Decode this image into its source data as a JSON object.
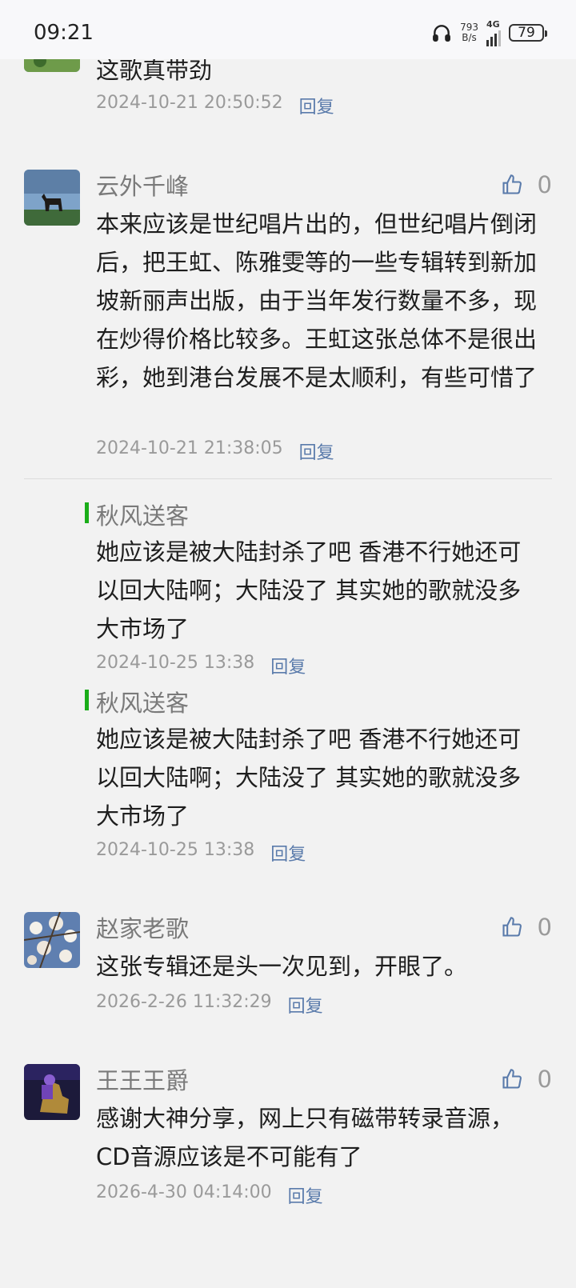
{
  "status": {
    "time": "09:21",
    "net_speed_value": "793",
    "net_speed_unit": "B/s",
    "network": "4G",
    "battery": "79"
  },
  "comments": [
    {
      "text": "这歌真带劲",
      "time": "2024-10-21 20:50:52",
      "reply": "回复"
    },
    {
      "user": "云外千峰",
      "likes": "0",
      "text": "本来应该是世纪唱片出的，但世纪唱片倒闭后，把王虹、陈雅雯等的一些专辑转到新加坡新丽声出版，由于当年发行数量不多，现在炒得价格比较多。王虹这张总体不是很出彩，她到港台发展不是太顺利，有些可惜了",
      "time": "2024-10-21 21:38:05",
      "reply": "回复",
      "replies": [
        {
          "user": "秋风送客",
          "text": "她应该是被大陆封杀了吧  香港不行她还可以回大陆啊；大陆没了 其实她的歌就没多大市场了",
          "time": "2024-10-25 13:38",
          "reply": "回复"
        },
        {
          "user": "秋风送客",
          "text": "她应该是被大陆封杀了吧  香港不行她还可以回大陆啊；大陆没了 其实她的歌就没多大市场了",
          "time": "2024-10-25 13:38",
          "reply": "回复"
        }
      ]
    },
    {
      "user": "赵家老歌",
      "likes": "0",
      "text": "这张专辑还是头一次见到，开眼了。",
      "time": "2026-2-26 11:32:29",
      "reply": "回复"
    },
    {
      "user": "王王王爵",
      "likes": "0",
      "text": "感谢大神分享，网上只有磁带转录音源，CD音源应该是不可能有了",
      "time": "2026-4-30 04:14:00",
      "reply": "回复"
    }
  ],
  "colors": {
    "background": "#f2f2f2",
    "reply_link": "#5a7bab",
    "reply_bar": "#1aad19"
  }
}
